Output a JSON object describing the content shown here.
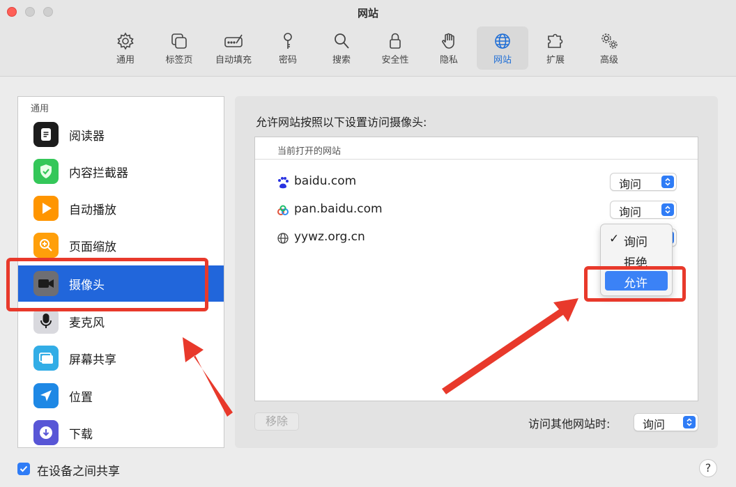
{
  "window": {
    "title": "网站"
  },
  "toolbar": {
    "items": [
      {
        "label": "通用",
        "icon": "gear-icon"
      },
      {
        "label": "标签页",
        "icon": "tabs-icon"
      },
      {
        "label": "自动填充",
        "icon": "autofill-icon"
      },
      {
        "label": "密码",
        "icon": "key-icon"
      },
      {
        "label": "搜索",
        "icon": "search-icon"
      },
      {
        "label": "安全性",
        "icon": "lock-icon"
      },
      {
        "label": "隐私",
        "icon": "hand-icon"
      },
      {
        "label": "网站",
        "icon": "globe-icon",
        "active": true
      },
      {
        "label": "扩展",
        "icon": "puzzle-icon"
      },
      {
        "label": "高级",
        "icon": "gears-icon"
      }
    ]
  },
  "sidebar": {
    "header": "通用",
    "items": [
      {
        "label": "阅读器",
        "icon": "reader-icon",
        "color": "#1c1c1c"
      },
      {
        "label": "内容拦截器",
        "icon": "shield-check-icon",
        "color": "#34c759"
      },
      {
        "label": "自动播放",
        "icon": "play-icon",
        "color": "#ff9500"
      },
      {
        "label": "页面缩放",
        "icon": "zoom-icon",
        "color": "#ff9f0a"
      },
      {
        "label": "摄像头",
        "icon": "camera-icon",
        "color": "#6e6e73",
        "selected": true
      },
      {
        "label": "麦克风",
        "icon": "microphone-icon",
        "color": "#8e8e93"
      },
      {
        "label": "屏幕共享",
        "icon": "screen-share-icon",
        "color": "#32ade6"
      },
      {
        "label": "位置",
        "icon": "location-icon",
        "color": "#1e88e5"
      },
      {
        "label": "下载",
        "icon": "download-icon",
        "color": "#5856d6"
      }
    ]
  },
  "main": {
    "title": "允许网站按照以下设置访问摄像头:",
    "list_header": "当前打开的网站",
    "sites": [
      {
        "name": "baidu.com",
        "icon": "baidu-icon",
        "setting": "询问"
      },
      {
        "name": "pan.baidu.com",
        "icon": "baidu-pan-icon",
        "setting": "询问"
      },
      {
        "name": "yywz.org.cn",
        "icon": "globe-icon",
        "setting": "询问"
      }
    ],
    "remove_label": "移除",
    "other_label": "访问其他网站时:",
    "other_setting": "询问"
  },
  "dropdown": {
    "options": [
      "询问",
      "拒绝",
      "允许"
    ],
    "checked": "询问",
    "highlighted": "允许",
    "check_mark": "✓"
  },
  "footer": {
    "share_label": "在设备之间共享",
    "share_checked": true,
    "help_label": "?"
  },
  "colors": {
    "accent": "#2166db",
    "annotation": "#e8392b"
  }
}
